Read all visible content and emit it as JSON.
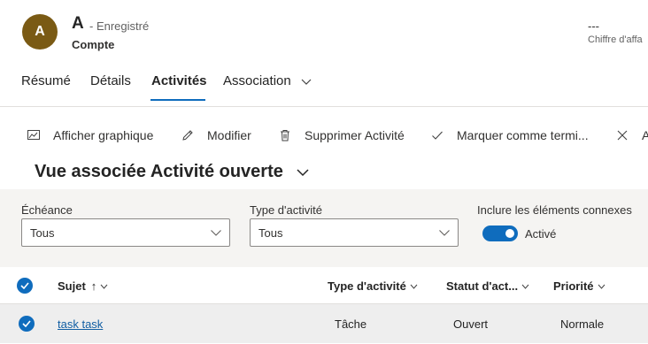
{
  "record": {
    "avatar_initial": "A",
    "name": "A",
    "status": "- Enregistré",
    "entity": "Compte",
    "kpi_value": "---",
    "kpi_label": "Chiffre d'affa"
  },
  "tabs": [
    {
      "label": "Résumé"
    },
    {
      "label": "Détails"
    },
    {
      "label": "Activités",
      "active": true
    },
    {
      "label": "Association"
    }
  ],
  "commands": [
    {
      "label": "Afficher graphique",
      "icon": "chart-icon"
    },
    {
      "label": "Modifier",
      "icon": "pencil-icon"
    },
    {
      "label": "Supprimer Activité",
      "icon": "trash-icon"
    },
    {
      "label": "Marquer comme termi...",
      "icon": "checkmark-icon"
    },
    {
      "label": "A",
      "icon": "close-icon"
    }
  ],
  "view": {
    "title": "Vue associée Activité ouverte"
  },
  "filters": {
    "due": {
      "label": "Échéance",
      "value": "Tous"
    },
    "activity_type": {
      "label": "Type d'activité",
      "value": "Tous"
    },
    "include_related": {
      "label": "Inclure les éléments connexes",
      "state": "Activé",
      "on": true
    }
  },
  "grid": {
    "columns": [
      {
        "label": "Sujet",
        "sort": "↑"
      },
      {
        "label": "Type d'activité"
      },
      {
        "label": "Statut d'act..."
      },
      {
        "label": "Priorité"
      }
    ],
    "rows": [
      {
        "subject": "task task",
        "type": "Tâche",
        "status": "Ouvert",
        "priority": "Normale",
        "selected": true
      }
    ]
  },
  "colors": {
    "accent": "#0f6cbd",
    "link": "#115ea3",
    "avatar": "#7a5a14"
  }
}
